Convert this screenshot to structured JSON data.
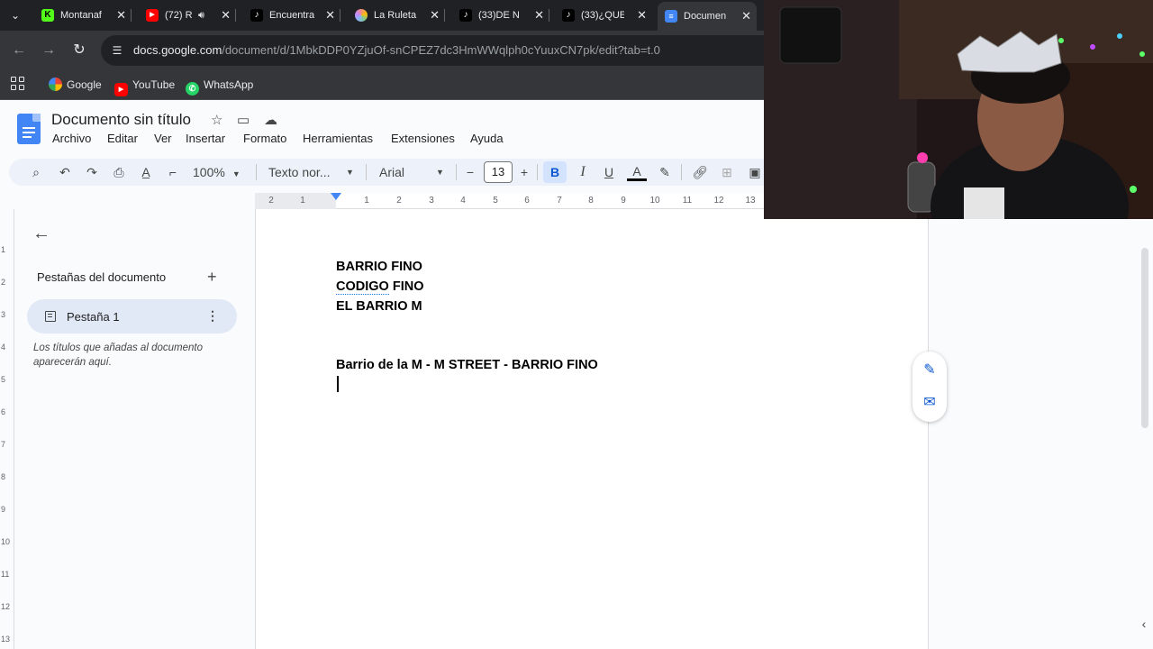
{
  "browser": {
    "tabs": [
      {
        "title": "Montanaf",
        "favicon": "K",
        "color": "#53fc18",
        "active": false
      },
      {
        "title": "(72) R",
        "favicon": "youtube-icon",
        "color": "#ff0000",
        "active": false,
        "audio": true
      },
      {
        "title": "Encuentra",
        "favicon": "tiktok-icon",
        "color": "#000000",
        "active": false
      },
      {
        "title": "La Ruleta",
        "favicon": "ruleta-icon",
        "color": "#c58af9",
        "active": false
      },
      {
        "title": "(33)DE N",
        "favicon": "tiktok-icon",
        "color": "#000000",
        "active": false
      },
      {
        "title": "(33)¿QUE",
        "favicon": "tiktok-icon",
        "color": "#000000",
        "active": false
      },
      {
        "title": "Documen",
        "favicon": "docs-icon",
        "color": "#4285f4",
        "active": true
      }
    ],
    "url_host": "docs.google.com",
    "url_path": "/document/d/1MbkDDP0YZjuOf-snCPEZ7dc3HmWWqlph0cYuuxCN7pk/edit?tab=t.0",
    "bookmarks": [
      {
        "label": "Google",
        "icon": "google-icon"
      },
      {
        "label": "YouTube",
        "icon": "youtube-icon"
      },
      {
        "label": "WhatsApp",
        "icon": "whatsapp-icon"
      }
    ]
  },
  "docs": {
    "title": "Documento sin título",
    "menu": [
      "Archivo",
      "Editar",
      "Ver",
      "Insertar",
      "Formato",
      "Herramientas",
      "Extensiones",
      "Ayuda"
    ],
    "toolbar": {
      "zoom": "100%",
      "style": "Texto nor...",
      "font": "Arial",
      "font_size": "13",
      "bold": "B",
      "italic": "I",
      "underline": "U",
      "text_color": "A",
      "decrease": "−",
      "increase": "+"
    },
    "ruler_numbers": [
      "2",
      "1",
      "1",
      "2",
      "3",
      "4",
      "5",
      "6",
      "7",
      "8",
      "9",
      "10",
      "11",
      "12",
      "13"
    ],
    "vruler_numbers": [
      "1",
      "2",
      "3",
      "4",
      "5",
      "6",
      "7",
      "8",
      "9",
      "10",
      "11",
      "12",
      "13"
    ],
    "outline": {
      "heading": "Pestañas del documento",
      "tab_label": "Pestaña 1",
      "hint": "Los títulos que añadas al documento aparecerán aquí."
    },
    "content": {
      "line1": "BARRIO FINO",
      "line2": "CODIGO",
      "line2b": " FINO",
      "line3": "EL BARRIO M",
      "line4": "Barrio de la M - M STREET - BARRIO FINO"
    }
  },
  "colors": {
    "accent": "#0b57d0",
    "docs_blue": "#4285f4",
    "chrome_dark": "#202124"
  }
}
